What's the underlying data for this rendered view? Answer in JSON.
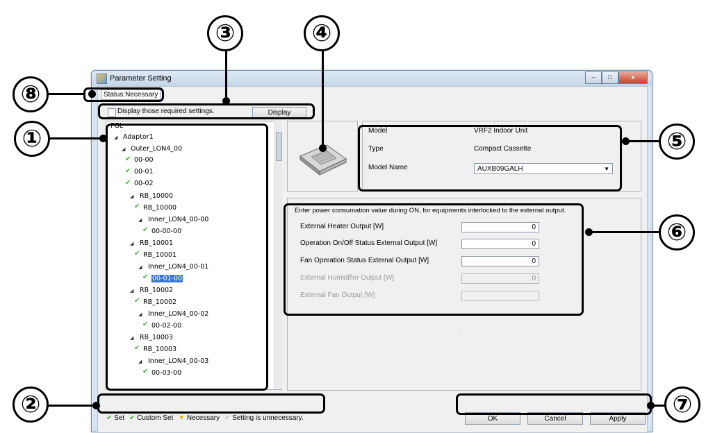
{
  "window": {
    "title": "Parameter Setting",
    "controls": [
      "–",
      "□",
      "x"
    ]
  },
  "status": {
    "text": "Status:Necessary"
  },
  "filter": {
    "checkbox_label": "Display those required settings.",
    "display_button": "Display"
  },
  "tree": {
    "root": "FGL",
    "adaptor": "Adaptor1",
    "outer": "Outer_LON4_00",
    "outer_children": [
      "00-00",
      "00-01",
      "00-02"
    ],
    "groups": [
      {
        "rb": "RB_10000",
        "rb_leaf": "RB_10000",
        "inner": "Inner_LON4_00-00",
        "inner_leaf": "00-00-00"
      },
      {
        "rb": "RB_10001",
        "rb_leaf": "RB_10001",
        "inner": "Inner_LON4_00-01",
        "inner_leaf": "00-01-00"
      },
      {
        "rb": "RB_10002",
        "rb_leaf": "RB_10002",
        "inner": "Inner_LON4_00-02",
        "inner_leaf": "00-02-00"
      },
      {
        "rb": "RB_10003",
        "rb_leaf": "RB_10003",
        "inner": "Inner_LON4_00-03",
        "inner_leaf": "00-03-00"
      }
    ],
    "selected": "00-01-00"
  },
  "unit_info": {
    "model_label": "Model",
    "model_value": "VRF2 Indoor Unit",
    "type_label": "Type",
    "type_value": "Compact Cassette",
    "model_name_label": "Model Name",
    "model_name_value": "AUXB09GALH"
  },
  "output": {
    "instruction": "Enter power consumation value during ON, for equipments interlocked to the external output.",
    "fields": [
      {
        "label": "External Heater Output [W]",
        "value": "0",
        "enabled": true
      },
      {
        "label": "Operation On/Off Status External Output [W]",
        "value": "0",
        "enabled": true
      },
      {
        "label": "Fan Operation Status External Output [W]",
        "value": "0",
        "enabled": true
      },
      {
        "label": "External Humidifier Output [W]",
        "value": "0",
        "enabled": false
      },
      {
        "label": "External Fan Output [W]",
        "value": "",
        "enabled": false
      }
    ],
    "footnote": "."
  },
  "legend": {
    "set": "Set",
    "custom_set": "Custom Set",
    "necessary": "Necessary",
    "unnecessary": "Setting is unnecessary."
  },
  "buttons": {
    "ok": "OK",
    "cancel": "Cancel",
    "apply": "Apply"
  },
  "callouts": [
    "①",
    "②",
    "③",
    "④",
    "⑤",
    "⑥",
    "⑦",
    "⑧"
  ],
  "colors": {
    "set_icon": "#40b040",
    "necessary_icon": "#e0b800",
    "selection": "#3a75d4"
  }
}
